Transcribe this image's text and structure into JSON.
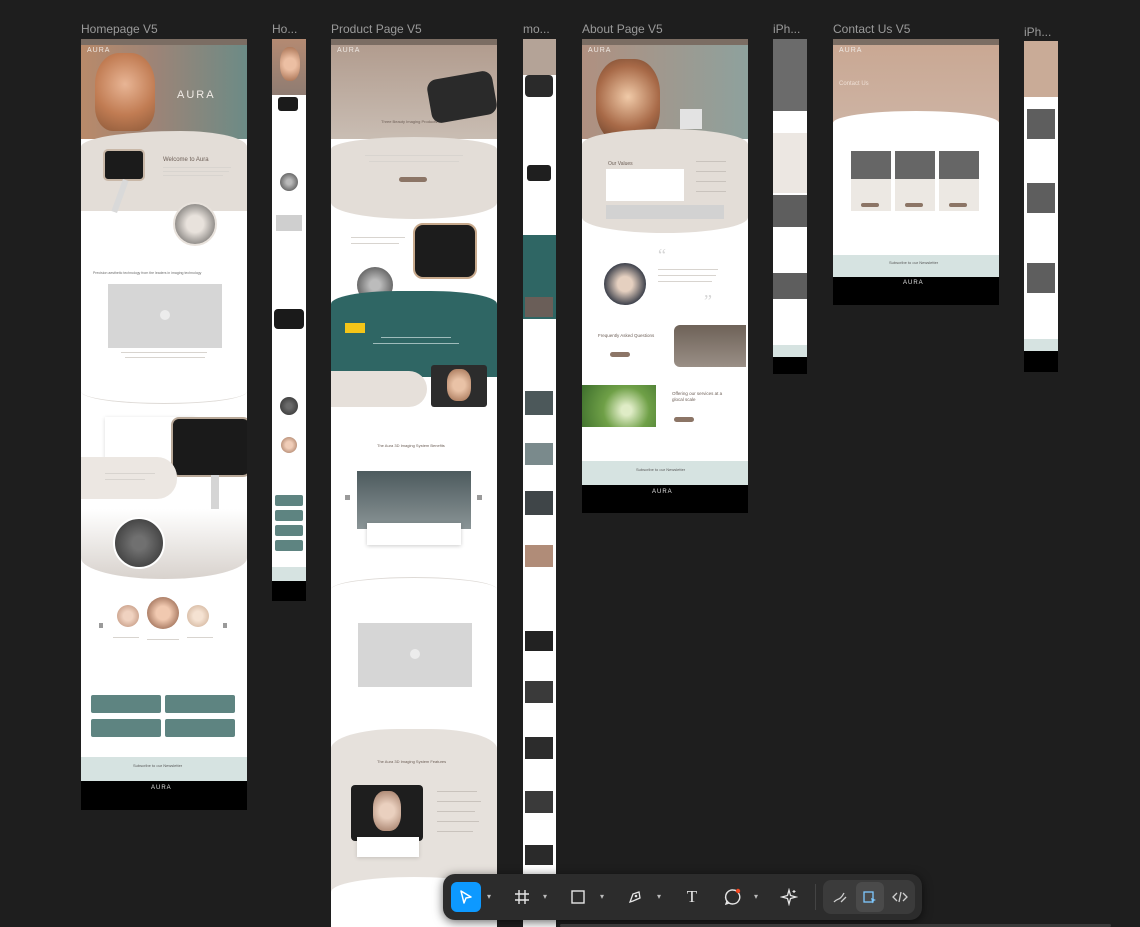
{
  "canvas": {
    "frames": [
      {
        "label": "Homepage V5"
      },
      {
        "label": "Ho..."
      },
      {
        "label": "Product Page V5"
      },
      {
        "label": "mo..."
      },
      {
        "label": "About Page V5"
      },
      {
        "label": "iPh..."
      },
      {
        "label": "Contact Us V5"
      },
      {
        "label": "iPh..."
      }
    ]
  },
  "homepage": {
    "logo": "AURA",
    "welcome": "Welcome to Aura",
    "tagline": "Precision aesthetic technology from the leaders in imaging technology",
    "newsletter": "Subscribe to our Newsletter",
    "footer_logo": "AURA"
  },
  "product": {
    "logo": "AURA",
    "hero_text": "Three Beauty Imaging Products",
    "benefits_title": "The Aura 3D Imaging System Benefits",
    "features_title": "The Aura 3D Imaging System Features"
  },
  "about": {
    "logo": "AURA",
    "values_title": "Our Values",
    "friends_title": "Frequently Asked Questions",
    "offer_title": "Offering our services at a glocal scale",
    "newsletter": "Subscribe to our Newsletter",
    "footer_logo": "AURA"
  },
  "contact": {
    "logo": "AURA",
    "title": "Contact Us",
    "newsletter": "Subscribe to our Newsletter",
    "footer_logo": "AURA"
  },
  "toolbar": {
    "tools": [
      {
        "name": "move-tool",
        "label": "Move"
      },
      {
        "name": "frame-tool",
        "label": "Frame"
      },
      {
        "name": "rectangle-tool",
        "label": "Rectangle"
      },
      {
        "name": "pen-tool",
        "label": "Pen"
      },
      {
        "name": "text-tool",
        "label": "T"
      },
      {
        "name": "comment-tool",
        "label": "Comment"
      },
      {
        "name": "actions-tool",
        "label": "Actions"
      },
      {
        "name": "draw-mode",
        "label": "Draw"
      },
      {
        "name": "design-mode",
        "label": "Design"
      },
      {
        "name": "dev-mode",
        "label": "Dev"
      }
    ],
    "active_color": "#0d99ff"
  }
}
